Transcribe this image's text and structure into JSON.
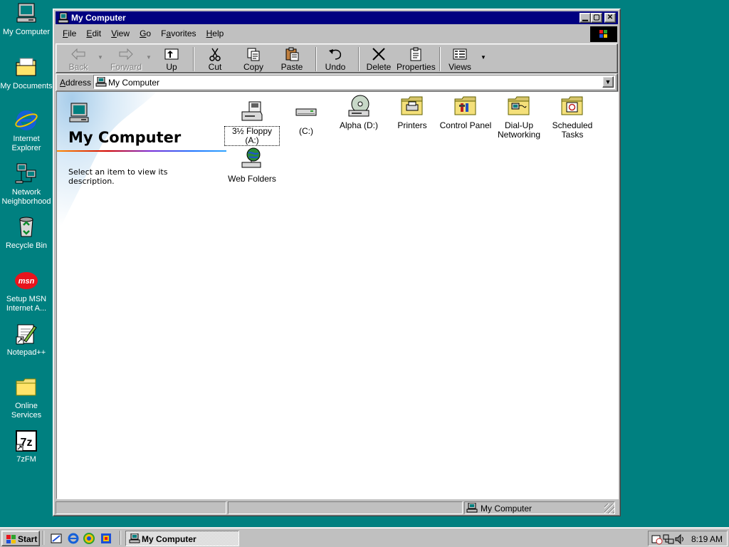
{
  "desktop": {
    "icons": [
      {
        "label": "My Computer"
      },
      {
        "label": "My Documents"
      },
      {
        "label": "Internet Explorer"
      },
      {
        "label": "Network Neighborhood"
      },
      {
        "label": "Recycle Bin"
      },
      {
        "label": "Setup MSN Internet A..."
      },
      {
        "label": "Notepad++"
      },
      {
        "label": "Online Services"
      },
      {
        "label": "7zFM"
      }
    ],
    "background_color": "#008080"
  },
  "window": {
    "title": "My Computer",
    "titlebar_color": "#000080",
    "menu": {
      "file": {
        "pre": "",
        "accel": "F",
        "post": "ile"
      },
      "edit": {
        "pre": "",
        "accel": "E",
        "post": "dit"
      },
      "view": {
        "pre": "",
        "accel": "V",
        "post": "iew"
      },
      "go": {
        "pre": "",
        "accel": "G",
        "post": "o"
      },
      "favorites": {
        "pre": "F",
        "accel": "a",
        "post": "vorites"
      },
      "help": {
        "pre": "",
        "accel": "H",
        "post": "elp"
      }
    },
    "toolbar": {
      "back": "Back",
      "forward": "Forward",
      "up": "Up",
      "cut": "Cut",
      "copy": "Copy",
      "paste": "Paste",
      "undo": "Undo",
      "delete": "Delete",
      "properties": "Properties",
      "views": "Views"
    },
    "address": {
      "label_pre": "",
      "label_accel": "A",
      "label_post": "ddress",
      "value": "My Computer"
    },
    "webview": {
      "title": "My Computer",
      "description": "Select an item to view its description."
    },
    "items": [
      {
        "label": "3½ Floppy (A:)",
        "icon": "floppy-drive-icon"
      },
      {
        "label": "(C:)",
        "icon": "hard-drive-icon"
      },
      {
        "label": "Alpha (D:)",
        "icon": "cd-drive-icon"
      },
      {
        "label": "Printers",
        "icon": "printers-folder-icon"
      },
      {
        "label": "Control Panel",
        "icon": "control-panel-folder-icon"
      },
      {
        "label": "Dial-Up Networking",
        "icon": "dial-up-networking-folder-icon"
      },
      {
        "label": "Scheduled Tasks",
        "icon": "scheduled-tasks-folder-icon"
      },
      {
        "label": "Web Folders",
        "icon": "web-folders-icon"
      }
    ],
    "status": {
      "pane1": "",
      "pane2": "",
      "zone": "My Computer"
    }
  },
  "taskbar": {
    "start_label": "Start",
    "tasks": [
      {
        "label": "My Computer"
      }
    ],
    "clock": "8:19 AM"
  }
}
